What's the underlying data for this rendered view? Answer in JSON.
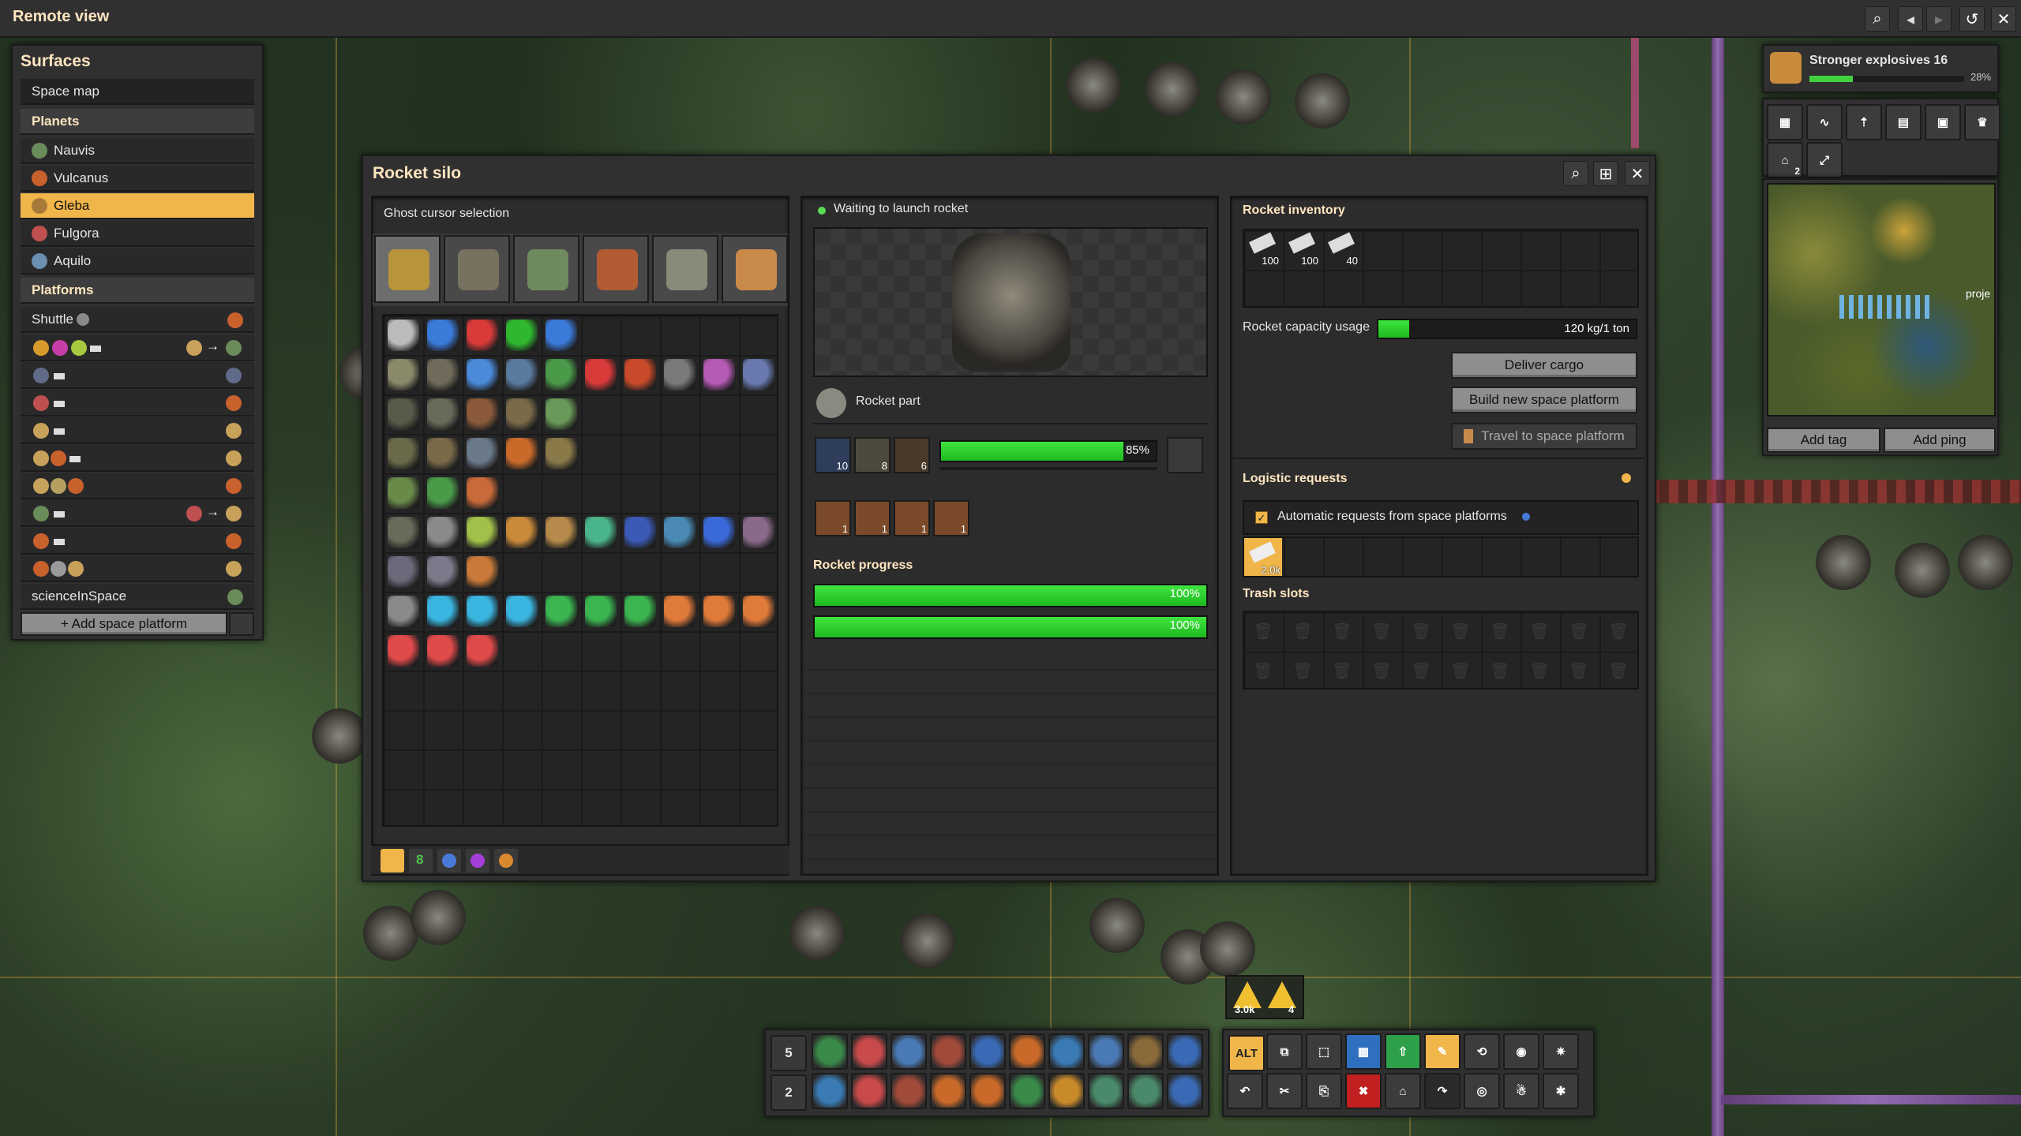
{
  "window": {
    "title": "Remote view"
  },
  "top_icons": [
    "search-icon",
    "back-icon",
    "forward-icon",
    "refresh-icon",
    "close-icon"
  ],
  "surfaces": {
    "title": "Surfaces",
    "space_map": "Space map",
    "planets_header": "Planets",
    "planets": [
      {
        "label": "Nauvis",
        "color": "#6a8c5a"
      },
      {
        "label": "Vulcanus",
        "color": "#c9612d"
      },
      {
        "label": "Gleba",
        "color": "#c8a25a",
        "selected": true
      },
      {
        "label": "Fulgora",
        "color": "#c05050"
      },
      {
        "label": "Aquilo",
        "color": "#6b8fb0"
      }
    ],
    "platforms_header": "Platforms",
    "platforms_first": "Shuttle",
    "platforms_last": "scienceInSpace",
    "add_platform": "+ Add space platform"
  },
  "rocket_silo": {
    "title": "Rocket silo",
    "ghost_cursor_title": "Ghost cursor selection",
    "status": "Waiting to launch rocket",
    "recipe": "Rocket part",
    "ingredients": [
      {
        "name": "processing-unit",
        "count": "10"
      },
      {
        "name": "low-density-structure",
        "count": "8"
      },
      {
        "name": "rocket-fuel",
        "count": "6"
      }
    ],
    "crafting_progress": 85,
    "crafting_progress_label": "85%",
    "output_counts": [
      "1",
      "1",
      "1",
      "1"
    ],
    "rocket_progress_title": "Rocket progress",
    "rocket_progress": [
      {
        "value": 100,
        "label": "100%"
      },
      {
        "value": 100,
        "label": "100%"
      }
    ],
    "rocket_inventory_title": "Rocket inventory",
    "inventory": [
      {
        "count": "100"
      },
      {
        "count": "100"
      },
      {
        "count": "40"
      }
    ],
    "capacity_label": "Rocket capacity usage",
    "capacity_value": "120 kg/1 ton",
    "capacity_fraction": 0.12,
    "deliver_cargo": "Deliver cargo",
    "build_platform": "Build new space platform",
    "travel_platform": "Travel to space platform",
    "logistic_title": "Logistic requests",
    "auto_requests": "Automatic requests from space platforms",
    "request_count": "2.0k",
    "trash_title": "Trash slots",
    "tab_numbers": [
      "8"
    ]
  },
  "research": {
    "name": "Stronger explosives 16",
    "progress": 28,
    "progress_label": "28%"
  },
  "minimap": {
    "add_tag": "Add tag",
    "add_ping": "Add ping",
    "label": "proje"
  },
  "right_icon_badge": "2",
  "alerts": [
    {
      "count": "3.0k"
    },
    {
      "count": "4"
    }
  ],
  "hotbar": {
    "row1": "5",
    "row2": "2",
    "alt": "ALT"
  }
}
